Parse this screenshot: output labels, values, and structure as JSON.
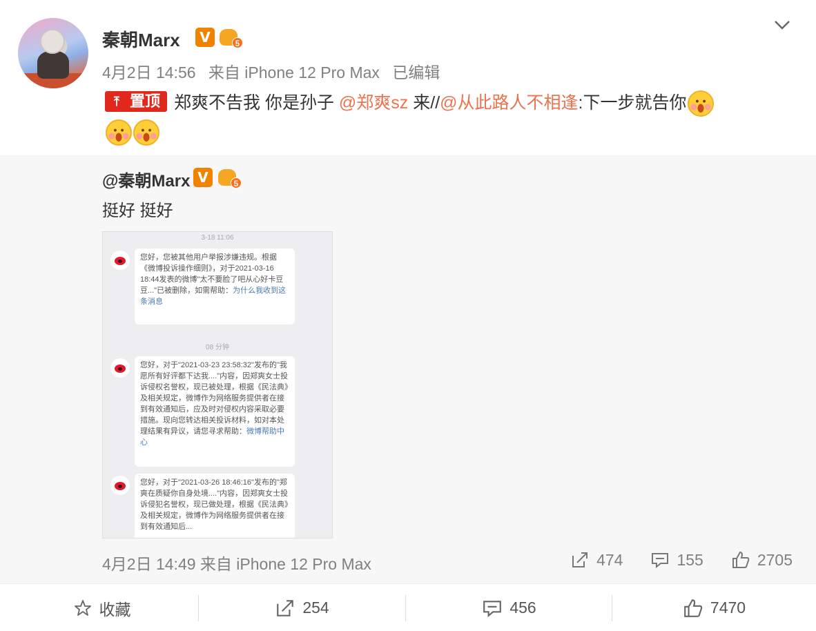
{
  "post": {
    "username": "秦朝Marx",
    "verified_badge": "V",
    "level": "5",
    "time": "4月2日 14:56",
    "source": "来自 iPhone 12 Pro Max",
    "edited": "已编辑",
    "pin_label": "置顶",
    "pin_icon": "pin-icon",
    "text_part1": "郑爽不告我 你是孙子 ",
    "mention1": "@郑爽sz",
    "text_part2": " 来//",
    "mention2": "@从此路人不相逢",
    "text_part3": ":下一步就告你",
    "emoji": "grin-emoji"
  },
  "repost": {
    "username": "@秦朝Marx",
    "verified_badge": "V",
    "level": "5",
    "text": "挺好 挺好",
    "screenshot": {
      "ts1": "3-18 11:06",
      "msg1": "您好，您被其他用户举报涉嫌违规。根据《微博投诉操作细则》，对于2021-03-16 18:44发表的微博\"太不要脸了吧从心好卡豆豆...\"已被删除，如需帮助：",
      "msg1_link": "为什么我收到这条消息",
      "ts2": "08 分钟",
      "msg2": "您好，对于\"2021-03-23 23:58:32\"发布的\"我愿所有好评都下达我....\"内容，因郑爽女士投诉侵权名誉权，现已被处理，根据《民法典》及相关规定，微博作为网络服务提供者在接到有效通知后，应及时对侵权内容采取必要措施。现向您转达相关投诉材料，如对本处理结果有异议，请您寻求帮助：",
      "msg2_link": "微博帮助中心",
      "msg3": "您好，对于\"2021-03-26 18:46:16\"发布的\"郑爽在质疑你自身处境....\"内容，因郑爽女士投诉侵犯名誉权，现已做处理，根据《民法典》及相关规定，微博作为网络服务提供者在接到有效通知后..."
    },
    "time": "4月2日 14:49",
    "source": "来自 iPhone 12 Pro Max",
    "share_count": "474",
    "comment_count": "155",
    "like_count": "2705"
  },
  "footer": {
    "favorite_label": "收藏",
    "share_count": "254",
    "comment_count": "456",
    "like_count": "7470"
  },
  "colors": {
    "accent": "#eb7350",
    "pin_red": "#e0281c",
    "verified_orange": "#f08200",
    "meta_gray": "#808080",
    "repost_bg": "#f7f7f7"
  }
}
